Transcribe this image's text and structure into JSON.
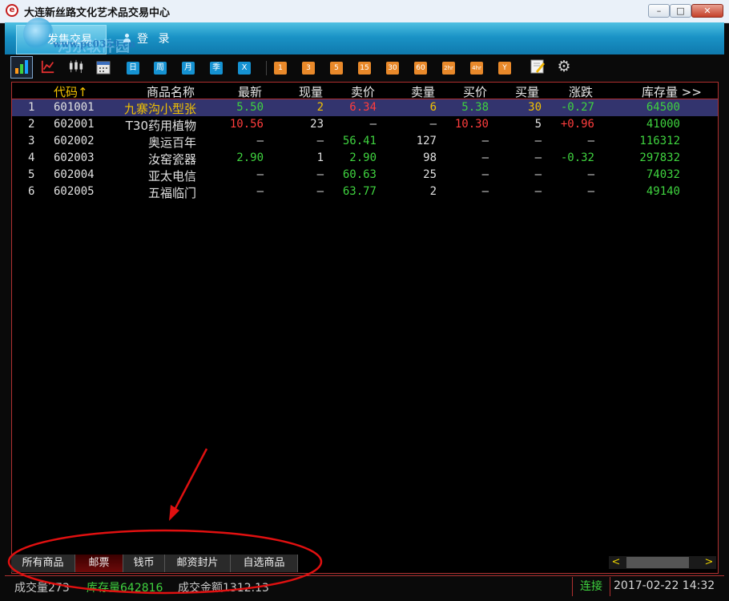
{
  "window": {
    "title": "大连新丝路文化艺术品交易中心",
    "minimize_glyph": "–",
    "maximize_glyph": "□",
    "close_glyph": "✕"
  },
  "banner": {
    "active_tab": "发售交易",
    "login": "登 录",
    "watermark_top": "河东软件园",
    "watermark_url": "www.pc0359.cn"
  },
  "toolbar": {
    "period_buttons": [
      "日",
      "周",
      "月",
      "季",
      "X"
    ],
    "minute_buttons": [
      "1",
      "3",
      "5",
      "15",
      "30",
      "60",
      "2hr",
      "4hr",
      "Y"
    ]
  },
  "table": {
    "columns": [
      "代码↑",
      "商品名称",
      "最新",
      "现量",
      "卖价",
      "卖量",
      "买价",
      "买量",
      "涨跌",
      "库存量 >>"
    ],
    "rows": [
      {
        "idx": "1",
        "code": "601001",
        "name": "九寨沟小型张",
        "latest": "5.50",
        "vol": "2",
        "ask": "6.34",
        "ask_vol": "6",
        "bid": "5.38",
        "bid_vol": "30",
        "change": "-0.27",
        "stock": "64500"
      },
      {
        "idx": "2",
        "code": "602001",
        "name": "T30药用植物",
        "latest": "10.56",
        "vol": "23",
        "ask": "—",
        "ask_vol": "—",
        "bid": "10.30",
        "bid_vol": "5",
        "change": "+0.96",
        "stock": "41000"
      },
      {
        "idx": "3",
        "code": "602002",
        "name": "奥运百年",
        "latest": "—",
        "vol": "—",
        "ask": "56.41",
        "ask_vol": "127",
        "bid": "—",
        "bid_vol": "—",
        "change": "—",
        "stock": "116312"
      },
      {
        "idx": "4",
        "code": "602003",
        "name": "汝窑瓷器",
        "latest": "2.90",
        "vol": "1",
        "ask": "2.90",
        "ask_vol": "98",
        "bid": "—",
        "bid_vol": "—",
        "change": "-0.32",
        "stock": "297832"
      },
      {
        "idx": "5",
        "code": "602004",
        "name": "亚太电信",
        "latest": "—",
        "vol": "—",
        "ask": "60.63",
        "ask_vol": "25",
        "bid": "—",
        "bid_vol": "—",
        "change": "—",
        "stock": "74032"
      },
      {
        "idx": "6",
        "code": "602005",
        "name": "五福临门",
        "latest": "—",
        "vol": "—",
        "ask": "63.77",
        "ask_vol": "2",
        "bid": "—",
        "bid_vol": "—",
        "change": "—",
        "stock": "49140"
      }
    ]
  },
  "bottom_tabs": [
    "所有商品",
    "邮票",
    "钱币",
    "邮资封片",
    "自选商品"
  ],
  "scroll": {
    "left": "<",
    "right": ">"
  },
  "status": {
    "volume": "成交量273",
    "stock": "库存量642816",
    "amount": "成交金额1312.13",
    "connection": "连接",
    "datetime": "2017-02-22 14:32"
  },
  "colors": {
    "accent_red": "#b03030",
    "banner_blue": "#1a93c6",
    "up_red": "#ff3d3d",
    "down_green": "#3fd33f",
    "selected_row": "#33346e"
  }
}
